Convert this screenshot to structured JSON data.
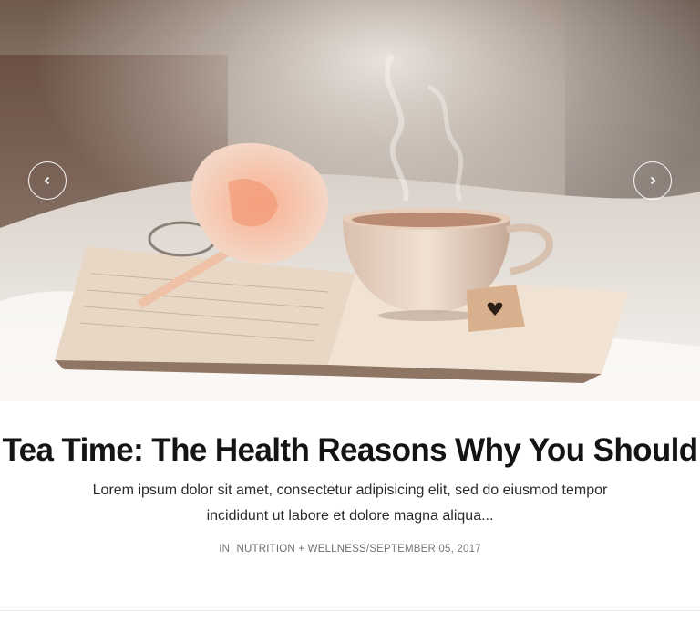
{
  "slider": {
    "image_icon": "tea-cup-book-photo",
    "prev_icon": "chevron-left-icon",
    "next_icon": "chevron-right-icon"
  },
  "post": {
    "title": "Tea Time: The Health Reasons Why You Should",
    "excerpt": "Lorem ipsum dolor sit amet, consectetur adipisicing elit, sed do eiusmod tempor incididunt ut labore et dolore magna aliqua...",
    "meta": {
      "in_label": "IN",
      "category": "NUTRITION + WELLNESS",
      "separator": "/",
      "date": "SEPTEMBER 05, 2017"
    }
  }
}
